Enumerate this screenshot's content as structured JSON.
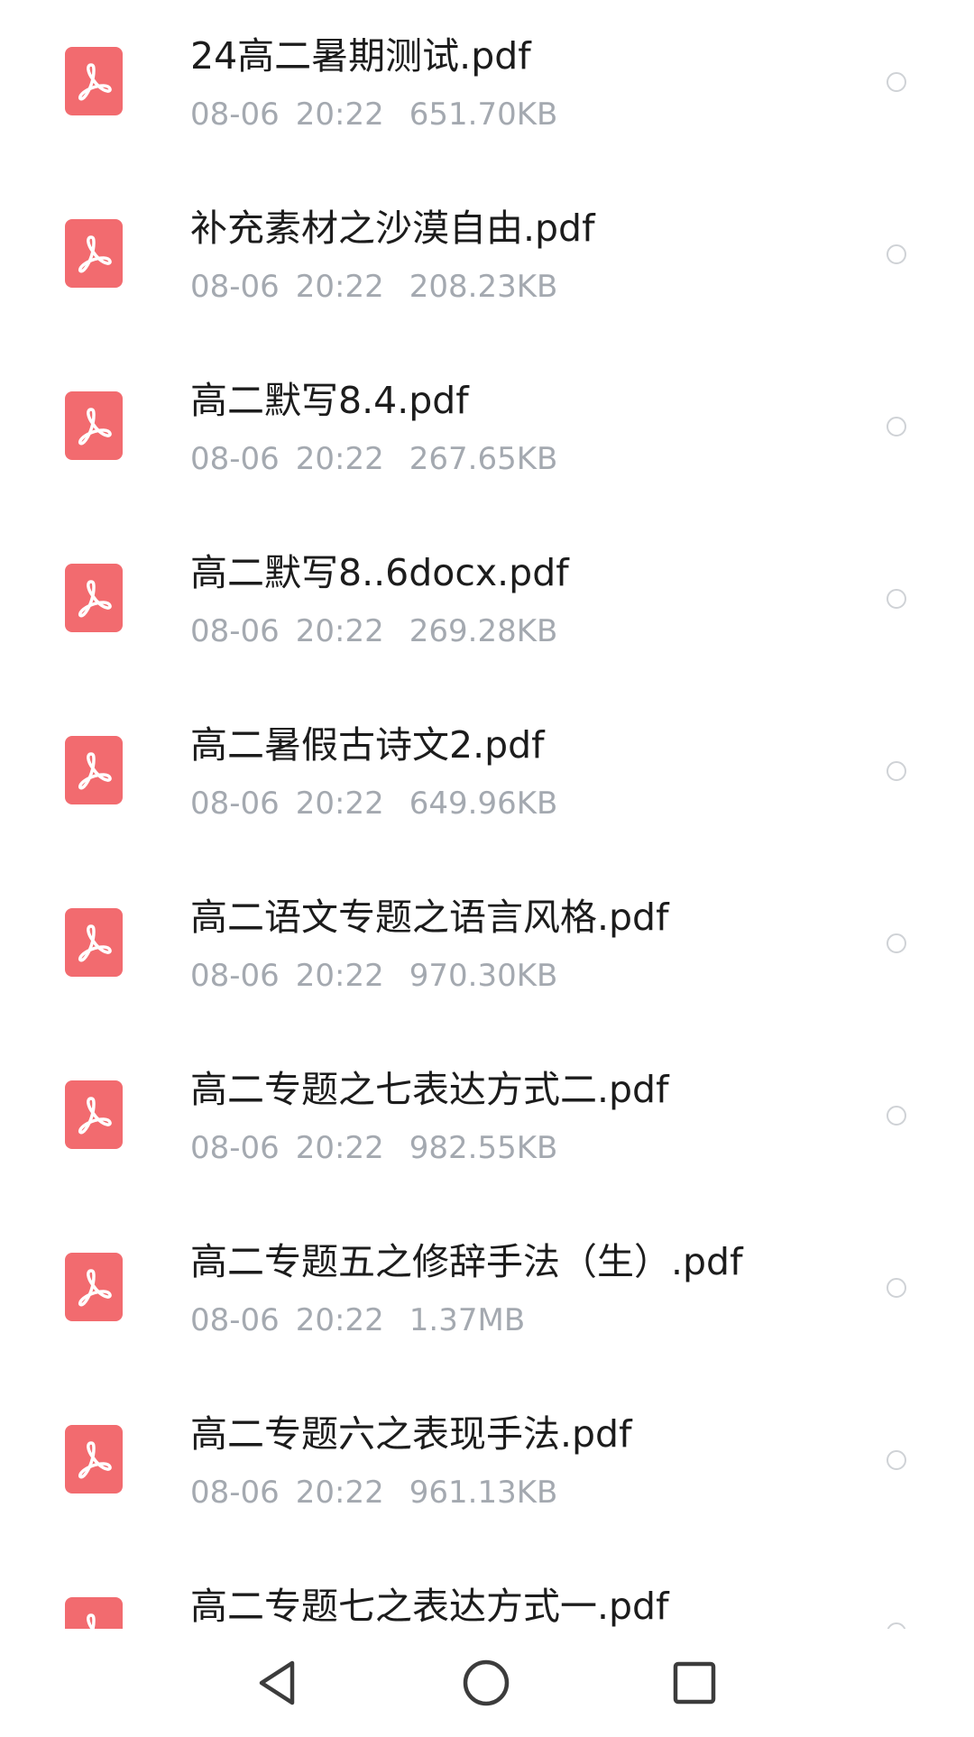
{
  "files": [
    {
      "name": "24高二暑期测试.pdf",
      "date": "08-06",
      "time": "20:22",
      "size": "651.70KB"
    },
    {
      "name": "补充素材之沙漠自由.pdf",
      "date": "08-06",
      "time": "20:22",
      "size": "208.23KB"
    },
    {
      "name": "高二默写8.4.pdf",
      "date": "08-06",
      "time": "20:22",
      "size": "267.65KB"
    },
    {
      "name": "高二默写8..6docx.pdf",
      "date": "08-06",
      "time": "20:22",
      "size": "269.28KB"
    },
    {
      "name": "高二暑假古诗文2.pdf",
      "date": "08-06",
      "time": "20:22",
      "size": "649.96KB"
    },
    {
      "name": "高二语文专题之语言风格.pdf",
      "date": "08-06",
      "time": "20:22",
      "size": "970.30KB"
    },
    {
      "name": "高二专题之七表达方式二.pdf",
      "date": "08-06",
      "time": "20:22",
      "size": "982.55KB"
    },
    {
      "name": "高二专题五之修辞手法（生）.pdf",
      "date": "08-06",
      "time": "20:22",
      "size": "1.37MB"
    },
    {
      "name": "高二专题六之表现手法.pdf",
      "date": "08-06",
      "time": "20:22",
      "size": "961.13KB"
    },
    {
      "name": "高二专题七之表达方式一.pdf"
    }
  ],
  "icons": {
    "file": "pdf-file-icon",
    "select": "radio-circle-icon",
    "nav": [
      "back-triangle-icon",
      "home-circle-icon",
      "recents-square-icon"
    ]
  },
  "colors": {
    "pdf_icon": "#f26b6f",
    "name_text": "#1c1c1c",
    "meta_text": "#a4a9b0",
    "radio_border": "#cfd2d6",
    "nav_icon": "#3c3c3c"
  }
}
